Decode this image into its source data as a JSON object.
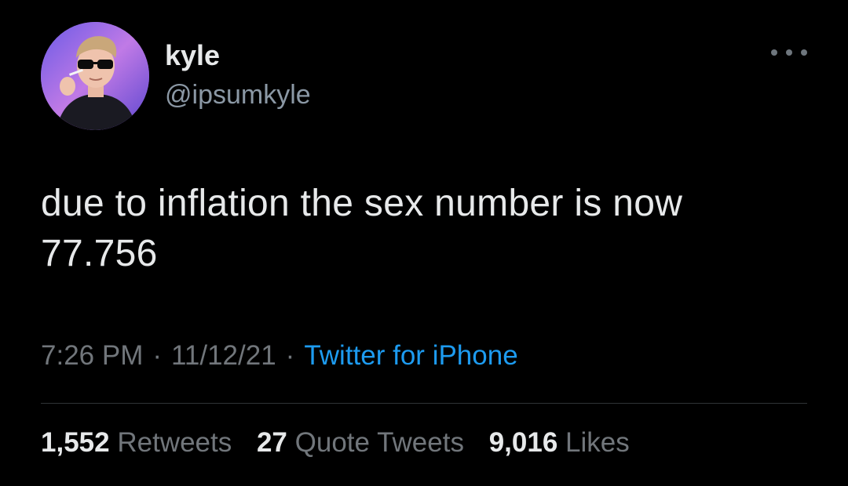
{
  "author": {
    "display_name": "kyle",
    "handle": "@ipsumkyle",
    "avatar_icon": "profile-photo"
  },
  "more_icon": "more-horizontal-icon",
  "tweet": {
    "text": "due to inflation the sex number is now\n77.756"
  },
  "meta": {
    "time": "7:26 PM",
    "separator1": "·",
    "date": "11/12/21",
    "separator2": "·",
    "source": "Twitter for iPhone"
  },
  "stats": {
    "retweets_count": "1,552",
    "retweets_label": "Retweets",
    "quotes_count": "27",
    "quotes_label": "Quote Tweets",
    "likes_count": "9,016",
    "likes_label": "Likes"
  },
  "colors": {
    "background": "#000000",
    "primary_text": "#e7e9ea",
    "secondary_text": "#71767b",
    "link": "#1d9bf0",
    "divider": "#2f3336"
  }
}
